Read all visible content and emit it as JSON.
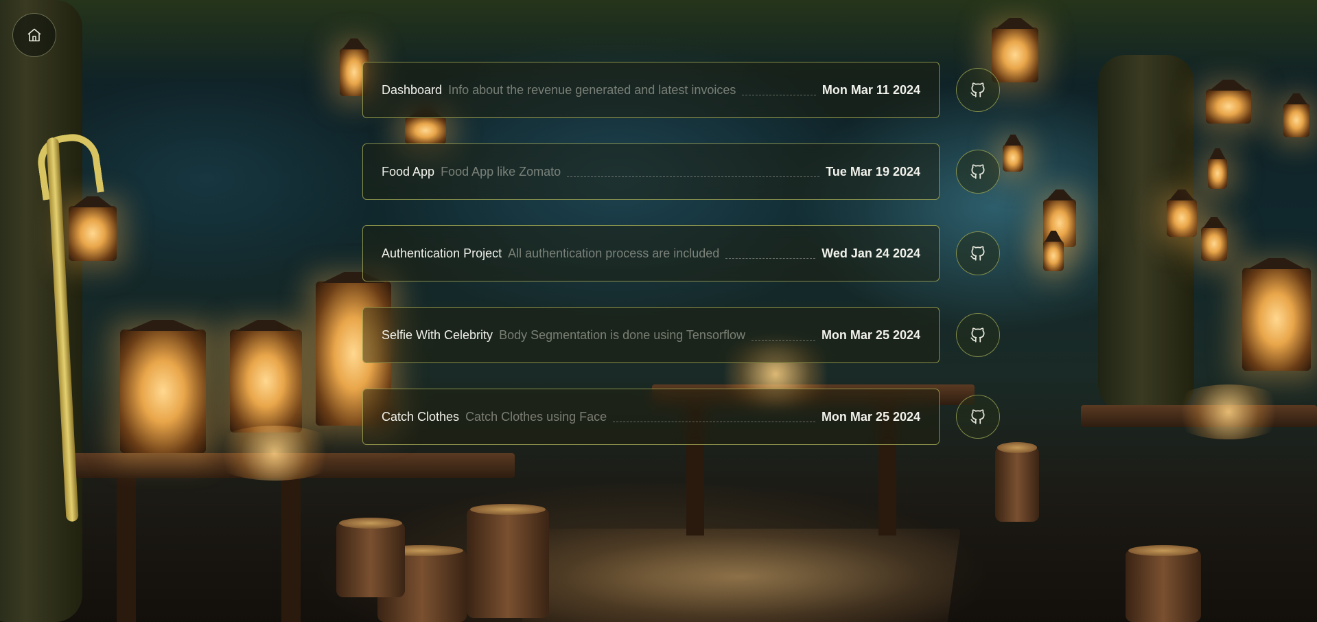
{
  "nav": {
    "home_icon": "home-icon"
  },
  "projects": [
    {
      "title": "Dashboard",
      "description": "Info about the revenue generated and latest invoices",
      "date": "Mon Mar 11 2024",
      "link_icon": "github-icon"
    },
    {
      "title": "Food App",
      "description": "Food App like Zomato",
      "date": "Tue Mar 19 2024",
      "link_icon": "github-icon"
    },
    {
      "title": "Authentication Project",
      "description": "All authentication process are included",
      "date": "Wed Jan 24 2024",
      "link_icon": "github-icon"
    },
    {
      "title": "Selfie With Celebrity",
      "description": "Body Segmentation is done using Tensorflow",
      "date": "Mon Mar 25 2024",
      "link_icon": "github-icon"
    },
    {
      "title": "Catch Clothes",
      "description": "Catch Clothes using Face",
      "date": "Mon Mar 25 2024",
      "link_icon": "github-icon"
    }
  ],
  "colors": {
    "card_border": "#afb45a",
    "title_text": "#f2f2ec",
    "description_text": "#c8c8be"
  }
}
